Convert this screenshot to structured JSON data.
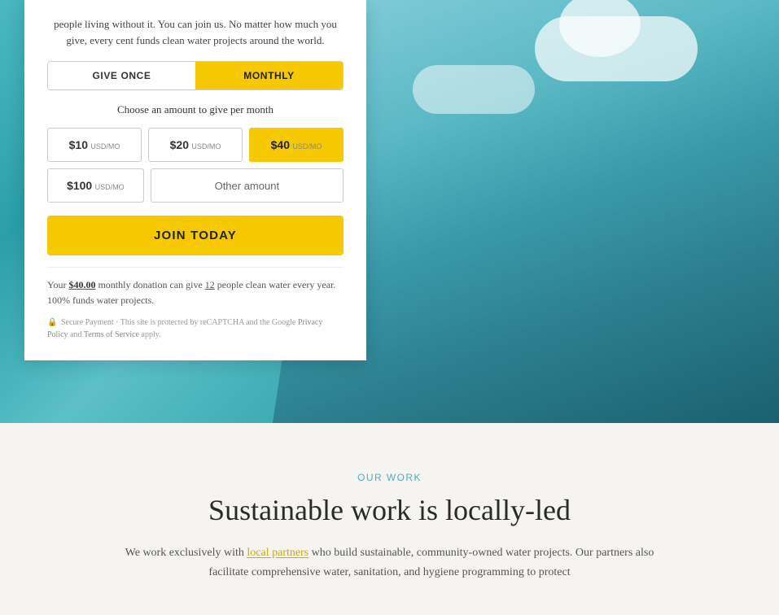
{
  "hero": {
    "intro_text": "people living without it. You can join us. No matter how much you give, every cent funds clean water projects around the world.",
    "toggle": {
      "give_once_label": "GIVE ONCE",
      "monthly_label": "MONTHLY",
      "active": "monthly"
    },
    "amount_section": {
      "label": "Choose an amount to give per month",
      "amounts": [
        {
          "value": "$10",
          "unit": "USD/mo",
          "selected": false
        },
        {
          "value": "$20",
          "unit": "USD/mo",
          "selected": false
        },
        {
          "value": "$40",
          "unit": "USD/mo",
          "selected": true
        }
      ],
      "row2": [
        {
          "value": "$100",
          "unit": "USD/mo",
          "selected": false
        },
        {
          "value": "Other amount",
          "unit": "",
          "selected": false
        }
      ]
    },
    "join_button": "JOIN TODAY",
    "donation_note": {
      "prefix": "Your ",
      "amount": "$40.00",
      "mid": " monthly donation can give ",
      "count": "12",
      "suffix": " people clean water every year. 100% funds water projects."
    },
    "secure_note": {
      "prefix": "Secure Payment · This site is protected by reCAPTCHA and the Google ",
      "privacy_link": "Privacy Policy",
      "and": " and ",
      "terms_link": "Terms of Service",
      "suffix": " apply."
    }
  },
  "our_work": {
    "section_label": "OUR WORK",
    "title": "Sustainable work is locally-led",
    "description": "We work exclusively with local partners who build sustainable, community-owned water projects. Our partners also facilitate comprehensive water, sanitation, and hygiene programming to protect"
  }
}
